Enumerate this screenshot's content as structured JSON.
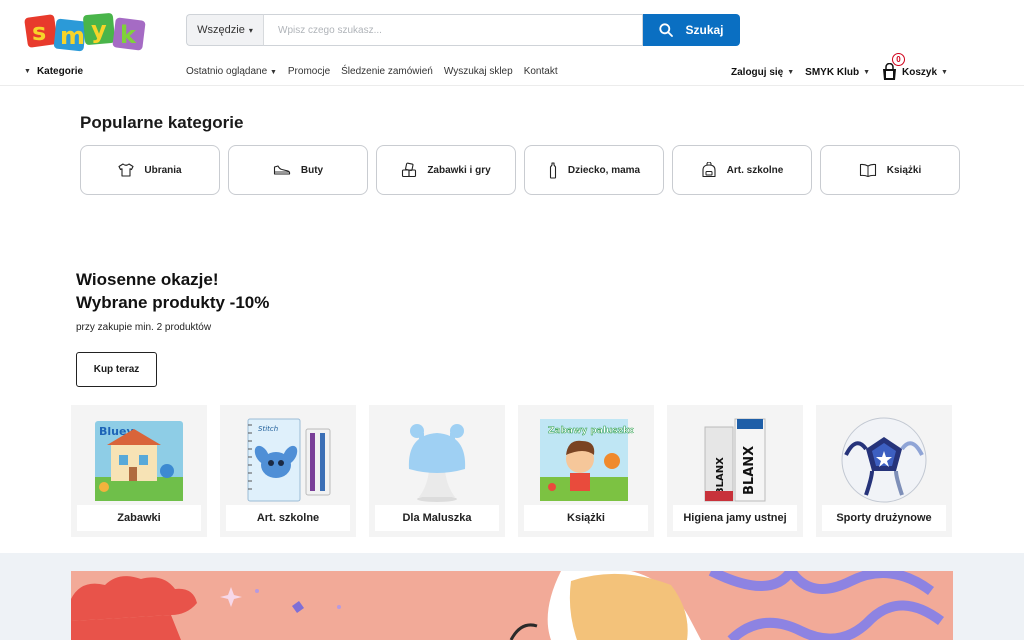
{
  "header": {
    "logo_text": "smyk",
    "search": {
      "scope_label": "Wszędzie",
      "placeholder": "Wpisz czego szukasz...",
      "button_label": "Szukaj"
    }
  },
  "nav": {
    "categories_label": "Kategorie",
    "links": [
      "Ostatnio oglądane",
      "Promocje",
      "Śledzenie zamówień",
      "Wyszukaj sklep",
      "Kontakt"
    ],
    "login_label": "Zaloguj się",
    "club_label": "SMYK Klub",
    "cart_label": "Koszyk",
    "cart_count": "0"
  },
  "popular": {
    "title": "Popularne kategorie",
    "items": [
      {
        "label": "Ubrania",
        "icon": "shirt-icon"
      },
      {
        "label": "Buty",
        "icon": "shoe-icon"
      },
      {
        "label": "Zabawki i gry",
        "icon": "blocks-icon"
      },
      {
        "label": "Dziecko, mama",
        "icon": "bottle-icon"
      },
      {
        "label": "Art. szkolne",
        "icon": "backpack-icon"
      },
      {
        "label": "Książki",
        "icon": "book-icon"
      }
    ]
  },
  "promo": {
    "title_line1": "Wiosenne okazje!",
    "title_line2": "Wybrane produkty -10%",
    "subtitle": "przy zakupie min. 2 produktów",
    "button_label": "Kup teraz",
    "products": [
      {
        "label": "Zabawki",
        "image_text": "Bluey"
      },
      {
        "label": "Art. szkolne",
        "image_text": "Stitch"
      },
      {
        "label": "Dla Maluszka",
        "image_text": ""
      },
      {
        "label": "Książki",
        "image_text": "Zabawy paluszkowe"
      },
      {
        "label": "Higiena jamy ustnej",
        "image_text": "BLANX"
      },
      {
        "label": "Sporty drużynowe",
        "image_text": ""
      }
    ]
  },
  "colors": {
    "search_button": "#0a6fc2",
    "cart_badge": "#d0021b",
    "banner_bg": "#f2aa98"
  }
}
